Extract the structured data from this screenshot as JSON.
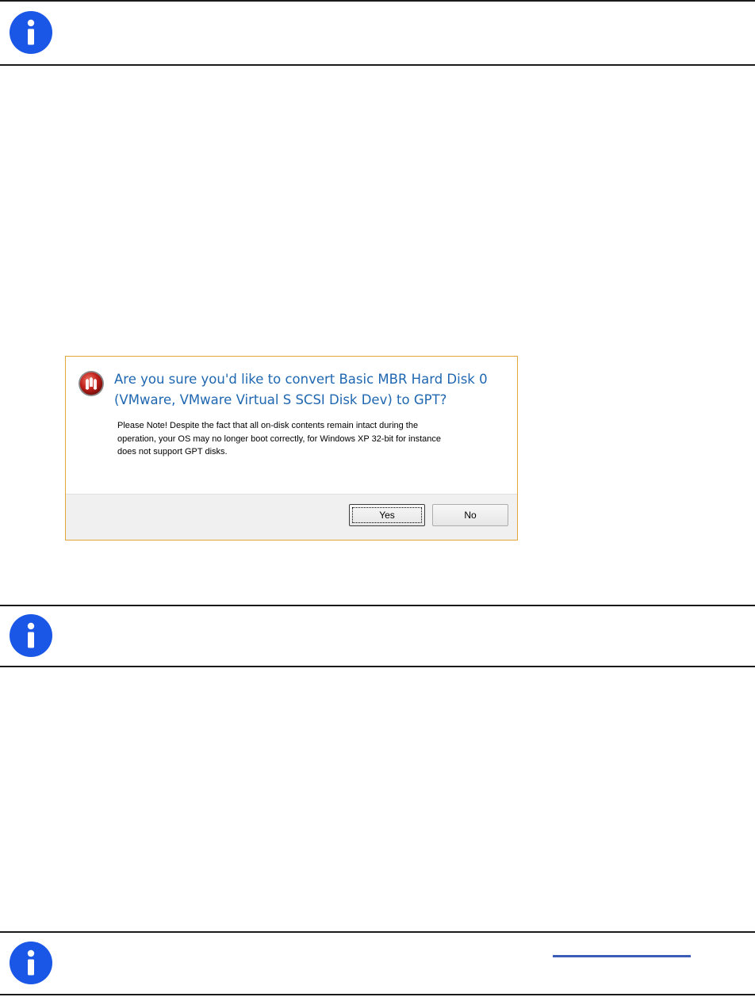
{
  "dialog": {
    "title_lines": [
      "Are you sure you'd like to convert Basic MBR Hard Disk 0",
      "(VMware, VMware Virtual S SCSI Disk Dev) to GPT?"
    ],
    "note_lines": [
      "Please Note! Despite the fact that all on-disk contents remain intact during the",
      "operation, your OS may no longer boot correctly, for Windows XP 32-bit for instance",
      "does not support GPT disks."
    ],
    "buttons": {
      "yes": "Yes",
      "no": "No"
    },
    "icon": "app-logo-icon",
    "title_color": "#1f67b0",
    "border_color": "#e3a63a"
  },
  "info_icon": {
    "icon": "info-icon",
    "color": "#1a57e6"
  }
}
